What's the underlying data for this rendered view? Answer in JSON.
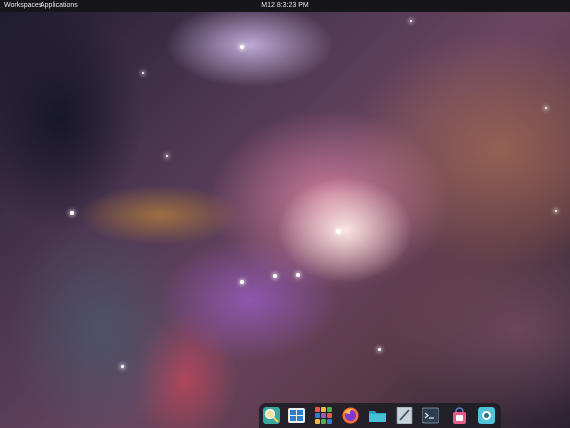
{
  "top_panel": {
    "workspaces_label": "Workspaces",
    "applications_label": "Applications",
    "clock_text": "M12 8:3:23 PM"
  },
  "dock": {
    "items": [
      {
        "icon": "magnifier-app-icon"
      },
      {
        "icon": "window-manager-icon"
      },
      {
        "icon": "app-grid-icon"
      },
      {
        "icon": "firefox-icon"
      },
      {
        "icon": "files-folder-icon"
      },
      {
        "icon": "text-editor-icon"
      },
      {
        "icon": "terminal-icon"
      },
      {
        "icon": "software-store-icon"
      },
      {
        "icon": "settings-camera-icon"
      }
    ]
  },
  "colors": {
    "panel_bg": "#16161a",
    "dock_bg": "#1e1e24"
  }
}
